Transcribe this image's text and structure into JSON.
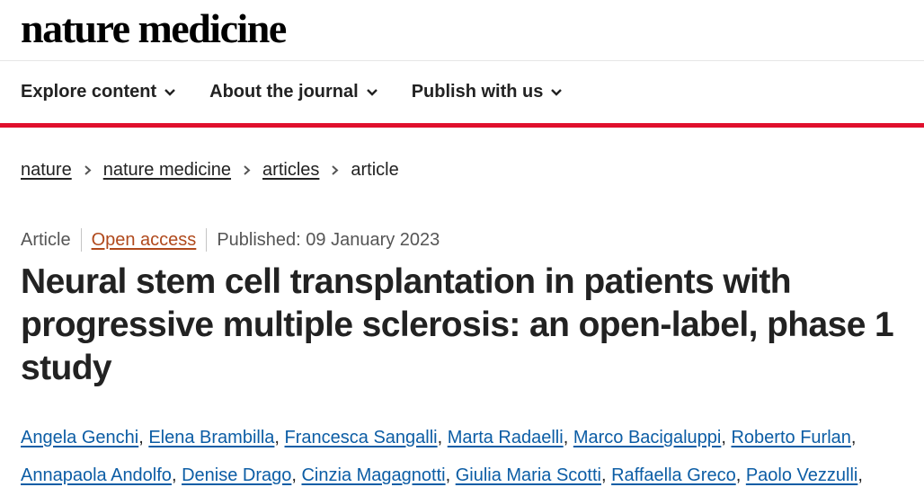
{
  "header": {
    "logo": "nature medicine"
  },
  "nav": {
    "items": [
      {
        "label": "Explore content"
      },
      {
        "label": "About the journal"
      },
      {
        "label": "Publish with us"
      }
    ]
  },
  "breadcrumbs": {
    "items": [
      "nature",
      "nature medicine",
      "articles"
    ],
    "current": "article"
  },
  "article": {
    "type": "Article",
    "access": "Open access",
    "published": "Published: 09 January 2023",
    "title_line1": "Neural stem cell transplantation in patients with",
    "title_line2": "progressive multiple sclerosis: an open-label, phase 1",
    "title_line3": "study"
  },
  "authors": [
    "Angela Genchi",
    "Elena Brambilla",
    "Francesca Sangalli",
    "Marta Radaelli",
    "Marco Bacigaluppi",
    "Roberto Furlan",
    "Annapaola Andolfo",
    "Denise Drago",
    "Cinzia Magagnotti",
    "Giulia Maria Scotti",
    "Raffaella Greco",
    "Paolo Vezzulli"
  ],
  "colors": {
    "accent_red": "#e0102d",
    "link_blue": "#0c5da5",
    "open_access": "#b0491c"
  }
}
